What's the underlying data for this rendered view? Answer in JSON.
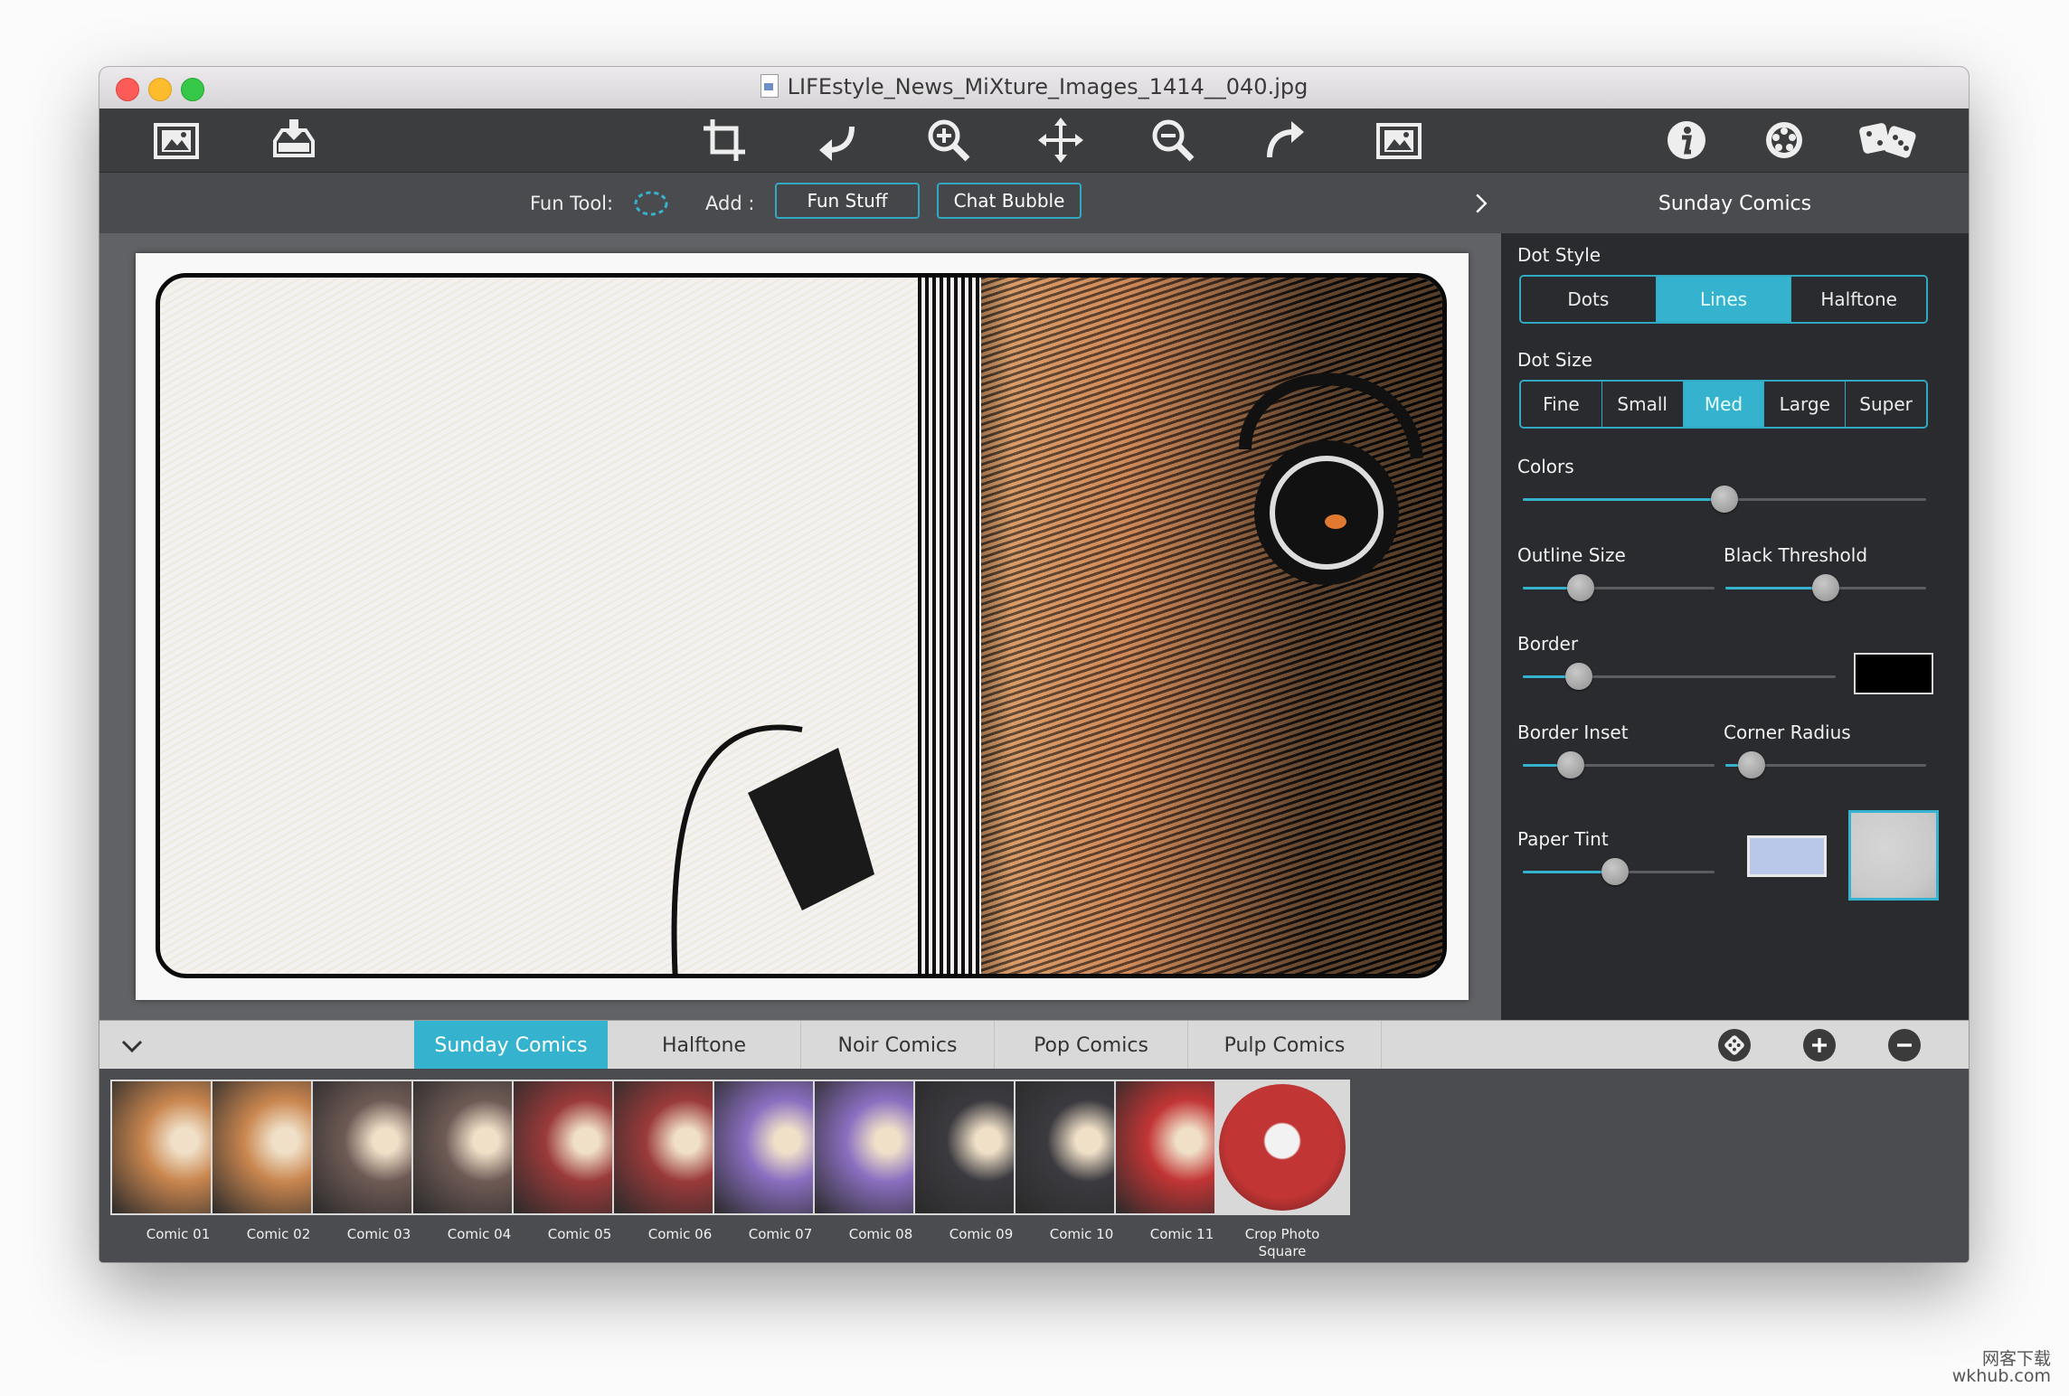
{
  "window": {
    "title": "LIFEstyle_News_MiXture_Images_1414__040.jpg"
  },
  "toolbar": {
    "buttons": [
      {
        "name": "open-image-icon"
      },
      {
        "name": "export-image-icon"
      },
      {
        "name": "crop-icon"
      },
      {
        "name": "undo-icon"
      },
      {
        "name": "zoom-in-icon"
      },
      {
        "name": "move-icon"
      },
      {
        "name": "zoom-out-icon"
      },
      {
        "name": "redo-icon"
      },
      {
        "name": "fit-image-icon"
      },
      {
        "name": "info-icon"
      },
      {
        "name": "settings-icon"
      },
      {
        "name": "random-dice-icon"
      }
    ]
  },
  "subbar": {
    "fun_tool_label": "Fun Tool:",
    "add_label": "Add :",
    "fun_stuff": "Fun Stuff",
    "chat_bubble": "Chat Bubble",
    "panel_title": "Sunday Comics"
  },
  "panel": {
    "dot_style": {
      "label": "Dot Style",
      "options": [
        "Dots",
        "Lines",
        "Halftone"
      ],
      "selected": "Lines"
    },
    "dot_size": {
      "label": "Dot Size",
      "options": [
        "Fine",
        "Small",
        "Med",
        "Large",
        "Super"
      ],
      "selected": "Med"
    },
    "colors": {
      "label": "Colors",
      "value": 0.5
    },
    "outline_size": {
      "label": "Outline Size",
      "value": 0.3
    },
    "black_threshold": {
      "label": "Black Threshold",
      "value": 0.5
    },
    "border": {
      "label": "Border",
      "value": 0.18,
      "color": "#000000"
    },
    "border_inset": {
      "label": "Border Inset",
      "value": 0.25
    },
    "corner_radius": {
      "label": "Corner Radius",
      "value": 0.13
    },
    "paper_tint": {
      "label": "Paper Tint",
      "value": 0.48,
      "tint_color": "#b9c8e8",
      "texture_color": "#c9c9c9"
    }
  },
  "tabs": {
    "items": [
      "Sunday Comics",
      "Halftone",
      "Noir Comics",
      "Pop Comics",
      "Pulp Comics"
    ],
    "selected": "Sunday Comics"
  },
  "presets": [
    {
      "label": "Comic 01",
      "color": "#c9864f"
    },
    {
      "label": "Comic 02",
      "color": "#c9864f"
    },
    {
      "label": "Comic 03",
      "color": "#6e5a55"
    },
    {
      "label": "Comic 04",
      "color": "#6e5a55"
    },
    {
      "label": "Comic 05",
      "color": "#9a3a3a"
    },
    {
      "label": "Comic 06",
      "color": "#9a3a3a"
    },
    {
      "label": "Comic 07",
      "color": "#8a6fc0"
    },
    {
      "label": "Comic 08",
      "color": "#8a6fc0"
    },
    {
      "label": "Comic 09",
      "color": "#3b3a3f"
    },
    {
      "label": "Comic 10",
      "color": "#3b3a3f"
    },
    {
      "label": "Comic 11",
      "color": "#c23535"
    },
    {
      "label": "Crop Photo Square",
      "color": "#c23535",
      "round": true
    }
  ],
  "watermark": {
    "line1": "网客下载",
    "line2": "wkhub.com"
  }
}
